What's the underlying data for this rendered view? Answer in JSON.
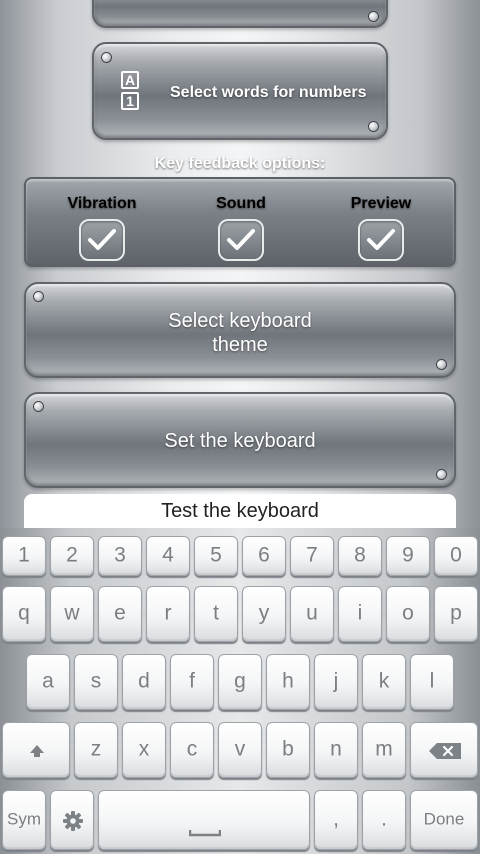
{
  "numbers_button": {
    "icon_top": "A",
    "icon_bottom": "1",
    "label": "Select words for numbers"
  },
  "feedback": {
    "title": "Key feedback options:",
    "options": [
      {
        "label": "Vibration",
        "checked": true
      },
      {
        "label": "Sound",
        "checked": true
      },
      {
        "label": "Preview",
        "checked": true
      }
    ]
  },
  "theme_button": {
    "line1": "Select keyboard",
    "line2": "theme"
  },
  "set_button": {
    "label": "Set the keyboard"
  },
  "test_field": {
    "value": "Test the keyboard"
  },
  "keyboard": {
    "row_numbers": [
      "1",
      "2",
      "3",
      "4",
      "5",
      "6",
      "7",
      "8",
      "9",
      "0"
    ],
    "row_top": [
      "q",
      "w",
      "e",
      "r",
      "t",
      "y",
      "u",
      "i",
      "o",
      "p"
    ],
    "row_middle": [
      "a",
      "s",
      "d",
      "f",
      "g",
      "h",
      "j",
      "k",
      "l"
    ],
    "row_bottom": [
      "z",
      "x",
      "c",
      "v",
      "b",
      "n",
      "m"
    ],
    "sym_label": "Sym",
    "comma_label": ",",
    "period_label": ".",
    "done_label": "Done",
    "shift_icon": "shift-icon",
    "backspace_icon": "backspace-icon",
    "settings_icon": "gear-icon",
    "space_icon": "space-icon"
  }
}
